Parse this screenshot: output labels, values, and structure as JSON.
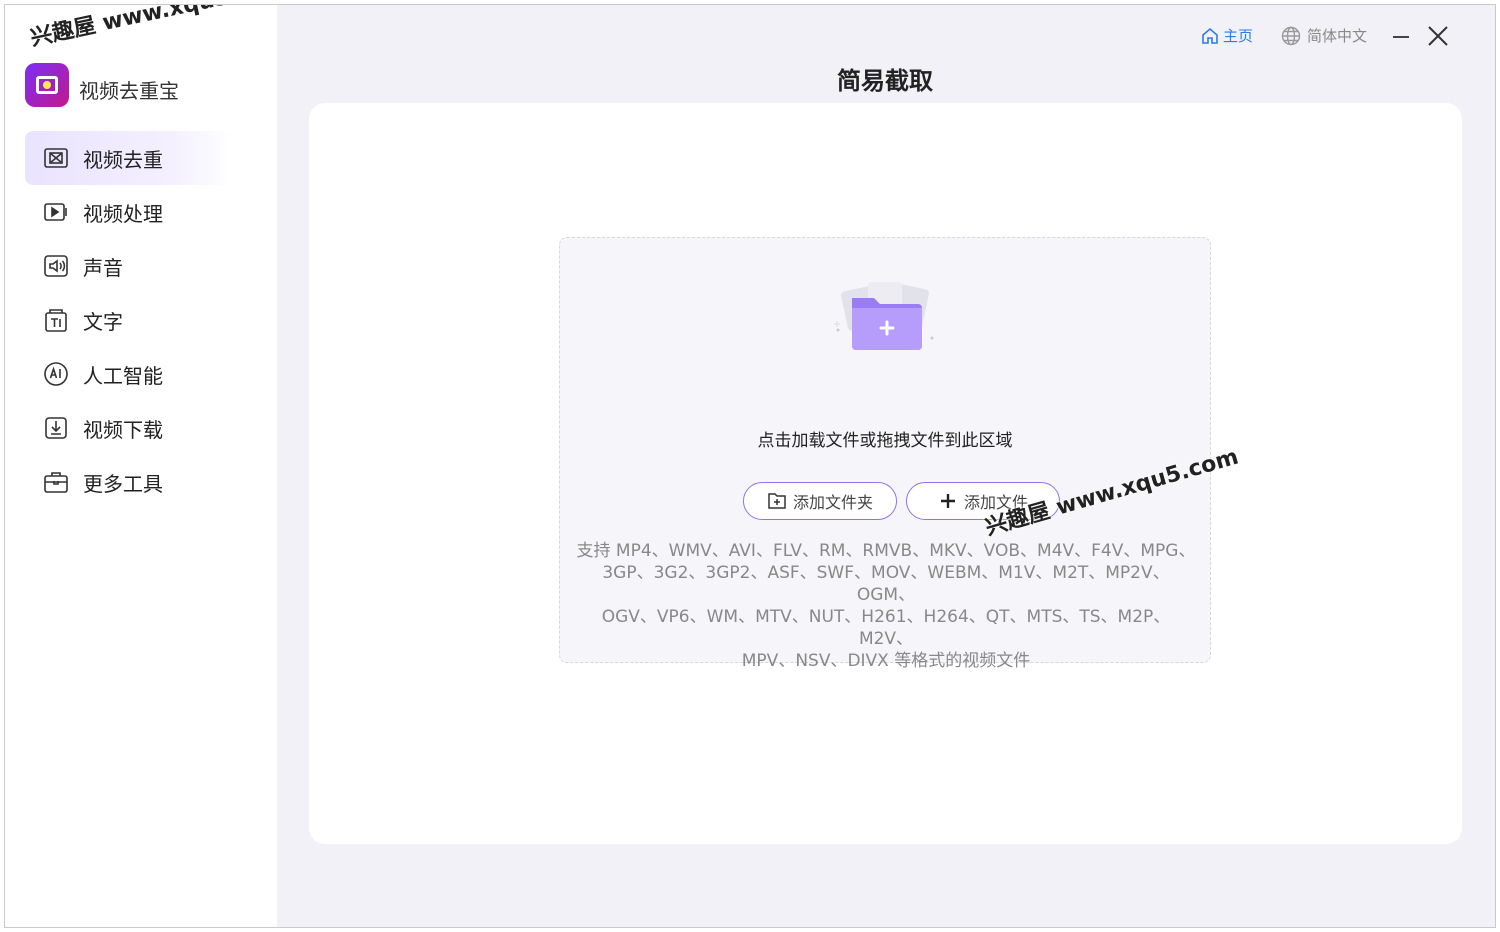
{
  "app": {
    "name": "视频去重宝",
    "logo_icon": "app-logo-icon"
  },
  "watermark": {
    "text": "兴趣屋 www.xqu5.com"
  },
  "sidebar": {
    "items": [
      {
        "label": "视频去重",
        "icon": "video-dedupe-icon",
        "active": true
      },
      {
        "label": "视频处理",
        "icon": "video-play-icon",
        "active": false
      },
      {
        "label": "声音",
        "icon": "speaker-icon",
        "active": false
      },
      {
        "label": "文字",
        "icon": "text-icon",
        "active": false
      },
      {
        "label": "人工智能",
        "icon": "ai-icon",
        "active": false
      },
      {
        "label": "视频下载",
        "icon": "download-icon",
        "active": false
      },
      {
        "label": "更多工具",
        "icon": "toolbox-icon",
        "active": false
      }
    ]
  },
  "topbar": {
    "home_label": "主页",
    "language_label": "简体中文"
  },
  "page": {
    "title": "简易截取"
  },
  "dropzone": {
    "hint": "点击加载文件或拖拽文件到此区域",
    "add_folder_label": "添加文件夹",
    "add_file_label": "添加文件",
    "formats_line1": "支持 MP4、WMV、AVI、FLV、RM、RMVB、MKV、VOB、M4V、F4V、MPG、",
    "formats_line2": "3GP、3G2、3GP2、ASF、SWF、MOV、WEBM、M1V、M2T、MP2V、OGM、",
    "formats_line3": "OGV、VP6、WM、MTV、NUT、H261、H264、QT、MTS、TS、M2P、M2V、",
    "formats_line4": "MPV、NSV、DIVX 等格式的视频文件"
  },
  "colors": {
    "accent": "#8f72f0",
    "link": "#2f7be6",
    "active_bg": "#e9e3ff",
    "content_bg": "#f1f1f7"
  }
}
